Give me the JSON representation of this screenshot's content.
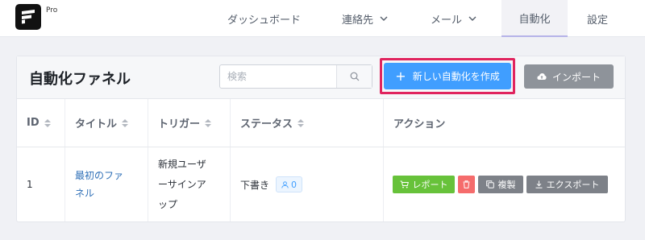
{
  "app": {
    "edition_label": "Pro"
  },
  "nav": {
    "items": [
      {
        "label": "ダッシュボード",
        "has_dropdown": false,
        "active": false
      },
      {
        "label": "連絡先",
        "has_dropdown": true,
        "active": false
      },
      {
        "label": "メール",
        "has_dropdown": true,
        "active": false
      },
      {
        "label": "自動化",
        "has_dropdown": false,
        "active": true
      },
      {
        "label": "設定",
        "has_dropdown": false,
        "active": false
      }
    ]
  },
  "page": {
    "title": "自動化ファネル"
  },
  "search": {
    "placeholder": "検索",
    "value": ""
  },
  "toolbar": {
    "create_label": "新しい自動化を作成",
    "import_label": "インポート"
  },
  "table": {
    "columns": [
      {
        "label": "ID",
        "sortable": true
      },
      {
        "label": "タイトル",
        "sortable": true
      },
      {
        "label": "トリガー",
        "sortable": true
      },
      {
        "label": "ステータス",
        "sortable": true
      },
      {
        "label": "アクション",
        "sortable": false
      }
    ],
    "rows": [
      {
        "id": "1",
        "title_line1": "最初のファ",
        "title_line2": "ネル",
        "trigger_line1": "新規ユーザ",
        "trigger_line2": "ーサインア",
        "trigger_line3": "ップ",
        "status": "下書き",
        "subscriber_count": "0",
        "actions": {
          "report": "レポート",
          "duplicate": "複製",
          "export": "エクスポート"
        }
      }
    ]
  },
  "colors": {
    "primary": "#409eff",
    "highlight_border": "#e0245e",
    "success": "#67c23a",
    "danger": "#f56c6c",
    "secondary": "#7d8188",
    "link": "#2e6fb7"
  }
}
